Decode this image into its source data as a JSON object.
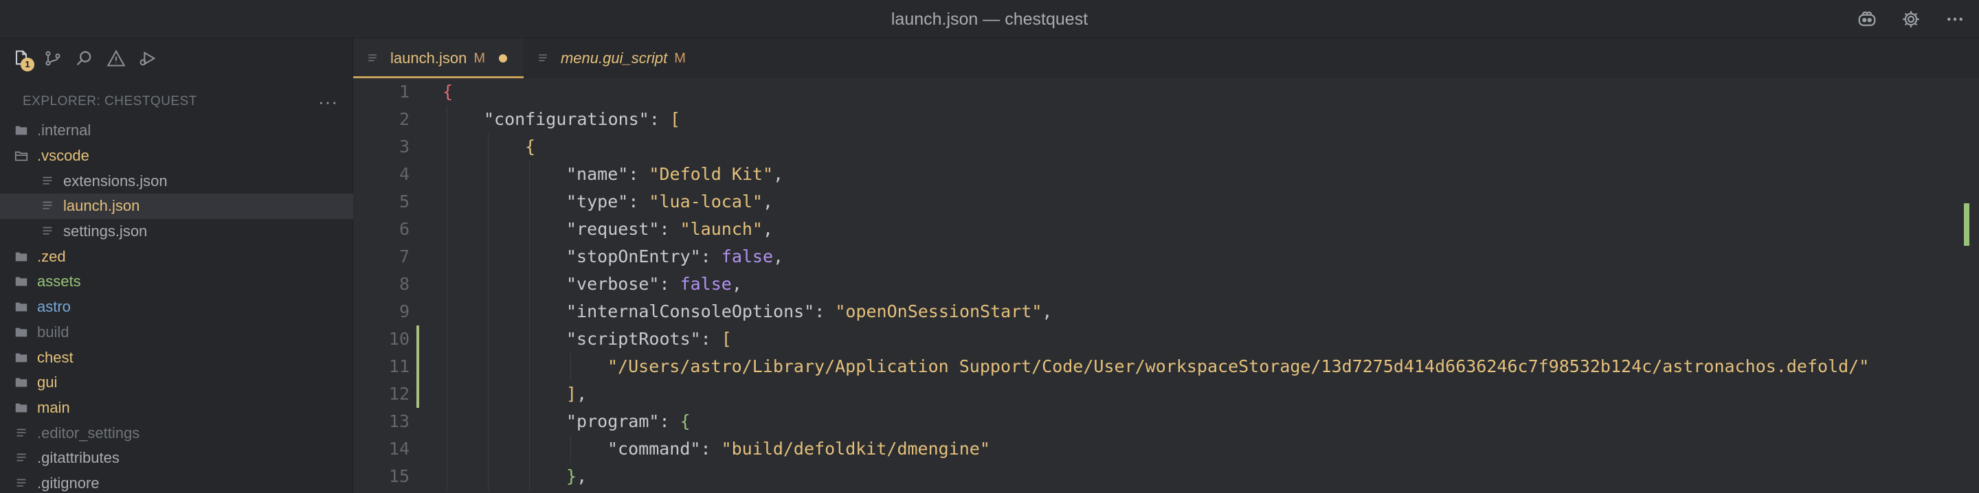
{
  "window": {
    "title": "launch.json — chestquest"
  },
  "title_actions": [
    {
      "name": "copilot-icon"
    },
    {
      "name": "gear-icon"
    },
    {
      "name": "more-icon"
    }
  ],
  "activity_bar": {
    "items": [
      {
        "name": "explorer-icon",
        "badge": "1"
      },
      {
        "name": "source-control-icon"
      },
      {
        "name": "search-icon"
      },
      {
        "name": "problems-icon"
      },
      {
        "name": "run-debug-icon"
      }
    ]
  },
  "explorer": {
    "title": "EXPLORER: CHESTQUEST",
    "more": "···",
    "items": [
      {
        "label": ".internal",
        "type": "folder",
        "depth": 0,
        "color": "#8b8f96"
      },
      {
        "label": ".vscode",
        "type": "folder-open",
        "depth": 0,
        "color": "#e5c07b"
      },
      {
        "label": "extensions.json",
        "type": "file",
        "depth": 1,
        "color": "#a9acb2"
      },
      {
        "label": "launch.json",
        "type": "file",
        "depth": 1,
        "color": "#e5c07b",
        "selected": true
      },
      {
        "label": "settings.json",
        "type": "file",
        "depth": 1,
        "color": "#a9acb2"
      },
      {
        "label": ".zed",
        "type": "folder",
        "depth": 0,
        "color": "#e5c07b"
      },
      {
        "label": "assets",
        "type": "folder",
        "depth": 0,
        "color": "#98c379"
      },
      {
        "label": "astro",
        "type": "folder",
        "depth": 0,
        "color": "#7aa7d9"
      },
      {
        "label": "build",
        "type": "folder",
        "depth": 0,
        "color": "#6f747c"
      },
      {
        "label": "chest",
        "type": "folder",
        "depth": 0,
        "color": "#e5c07b"
      },
      {
        "label": "gui",
        "type": "folder",
        "depth": 0,
        "color": "#e5c07b"
      },
      {
        "label": "main",
        "type": "folder",
        "depth": 0,
        "color": "#e5c07b"
      },
      {
        "label": ".editor_settings",
        "type": "file",
        "depth": 0,
        "color": "#6f747c"
      },
      {
        "label": ".gitattributes",
        "type": "file",
        "depth": 0,
        "color": "#a9acb2"
      },
      {
        "label": ".gitignore",
        "type": "file",
        "depth": 0,
        "color": "#a9acb2"
      }
    ]
  },
  "tabs": [
    {
      "label": "launch.json",
      "status": "M",
      "active": true,
      "dirty": true,
      "italic": false
    },
    {
      "label": "menu.gui_script",
      "status": "M",
      "active": false,
      "dirty": false,
      "italic": true
    }
  ],
  "code_lines": [
    {
      "n": "1",
      "indent": 0,
      "tokens": [
        {
          "t": "{",
          "c": "br1"
        }
      ]
    },
    {
      "n": "2",
      "indent": 1,
      "tokens": [
        {
          "t": "\"configurations\"",
          "c": "k"
        },
        {
          "t": ": ",
          "c": "p"
        },
        {
          "t": "[",
          "c": "br2"
        }
      ]
    },
    {
      "n": "3",
      "indent": 2,
      "tokens": [
        {
          "t": "{",
          "c": "br2"
        }
      ]
    },
    {
      "n": "4",
      "indent": 3,
      "tokens": [
        {
          "t": "\"name\"",
          "c": "k"
        },
        {
          "t": ": ",
          "c": "p"
        },
        {
          "t": "\"Defold Kit\"",
          "c": "s"
        },
        {
          "t": ",",
          "c": "p"
        }
      ]
    },
    {
      "n": "5",
      "indent": 3,
      "tokens": [
        {
          "t": "\"type\"",
          "c": "k"
        },
        {
          "t": ": ",
          "c": "p"
        },
        {
          "t": "\"lua-local\"",
          "c": "s"
        },
        {
          "t": ",",
          "c": "p"
        }
      ]
    },
    {
      "n": "6",
      "indent": 3,
      "tokens": [
        {
          "t": "\"request\"",
          "c": "k"
        },
        {
          "t": ": ",
          "c": "p"
        },
        {
          "t": "\"launch\"",
          "c": "s"
        },
        {
          "t": ",",
          "c": "p"
        }
      ]
    },
    {
      "n": "7",
      "indent": 3,
      "tokens": [
        {
          "t": "\"stopOnEntry\"",
          "c": "k"
        },
        {
          "t": ": ",
          "c": "p"
        },
        {
          "t": "false",
          "c": "b"
        },
        {
          "t": ",",
          "c": "p"
        }
      ]
    },
    {
      "n": "8",
      "indent": 3,
      "tokens": [
        {
          "t": "\"verbose\"",
          "c": "k"
        },
        {
          "t": ": ",
          "c": "p"
        },
        {
          "t": "false",
          "c": "b"
        },
        {
          "t": ",",
          "c": "p"
        }
      ]
    },
    {
      "n": "9",
      "indent": 3,
      "tokens": [
        {
          "t": "\"internalConsoleOptions\"",
          "c": "k"
        },
        {
          "t": ": ",
          "c": "p"
        },
        {
          "t": "\"openOnSessionStart\"",
          "c": "s"
        },
        {
          "t": ",",
          "c": "p"
        }
      ]
    },
    {
      "n": "10",
      "indent": 3,
      "modified": true,
      "tokens": [
        {
          "t": "\"scriptRoots\"",
          "c": "k"
        },
        {
          "t": ": ",
          "c": "p"
        },
        {
          "t": "[",
          "c": "br2"
        }
      ]
    },
    {
      "n": "11",
      "indent": 4,
      "modified": true,
      "tokens": [
        {
          "t": "\"/Users/astro/Library/Application Support/Code/User/workspaceStorage/13d7275d414d6636246c7f98532b124c/astronachos.defold/\"",
          "c": "s"
        }
      ]
    },
    {
      "n": "12",
      "indent": 3,
      "modified": true,
      "tokens": [
        {
          "t": "]",
          "c": "br2"
        },
        {
          "t": ",",
          "c": "p"
        }
      ]
    },
    {
      "n": "13",
      "indent": 3,
      "tokens": [
        {
          "t": "\"program\"",
          "c": "k"
        },
        {
          "t": ": ",
          "c": "p"
        },
        {
          "t": "{",
          "c": "br3"
        }
      ]
    },
    {
      "n": "14",
      "indent": 4,
      "tokens": [
        {
          "t": "\"command\"",
          "c": "k"
        },
        {
          "t": ": ",
          "c": "p"
        },
        {
          "t": "\"build/defoldkit/dmengine\"",
          "c": "s"
        }
      ]
    },
    {
      "n": "15",
      "indent": 3,
      "tokens": [
        {
          "t": "}",
          "c": "br3"
        },
        {
          "t": ",",
          "c": "p"
        }
      ]
    }
  ],
  "colors": {
    "accent": "#e5c07b",
    "modified_gutter": "#a7c080",
    "string": "#e5c07b",
    "boolean": "#b392f0"
  }
}
